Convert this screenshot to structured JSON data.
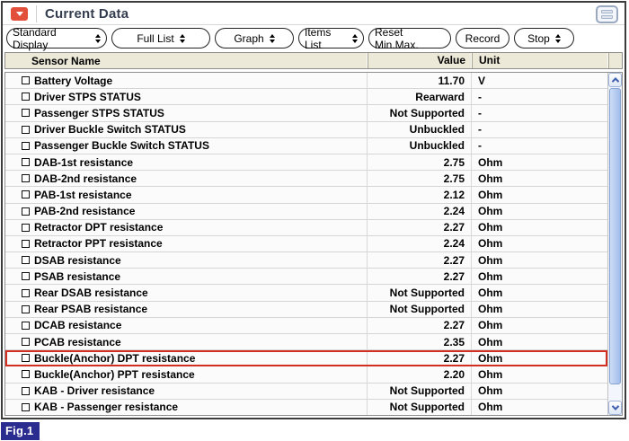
{
  "window": {
    "title": "Current Data",
    "titlebar_icon": "red-dropdown-caret",
    "corner_icon": "window-stack"
  },
  "toolbar": {
    "buttons": [
      {
        "label": "Standard Display",
        "dropdown": true
      },
      {
        "label": "Full List",
        "dropdown": true
      },
      {
        "label": "Graph",
        "dropdown": true
      },
      {
        "label": "Items List",
        "dropdown": true
      },
      {
        "label": "Reset Min.Max.",
        "dropdown": false
      },
      {
        "label": "Record",
        "dropdown": false
      },
      {
        "label": "Stop",
        "dropdown": true
      }
    ]
  },
  "table": {
    "columns": {
      "name": "Sensor Name",
      "value": "Value",
      "unit": "Unit"
    },
    "rows": [
      {
        "name": "Battery Voltage",
        "value": "11.70",
        "unit": "V",
        "checked": false,
        "highlighted": false
      },
      {
        "name": "Driver STPS STATUS",
        "value": "Rearward",
        "unit": "-",
        "checked": false,
        "highlighted": false
      },
      {
        "name": "Passenger STPS STATUS",
        "value": "Not Supported",
        "unit": "-",
        "checked": false,
        "highlighted": false
      },
      {
        "name": "Driver Buckle Switch STATUS",
        "value": "Unbuckled",
        "unit": "-",
        "checked": false,
        "highlighted": false
      },
      {
        "name": "Passenger Buckle Switch STATUS",
        "value": "Unbuckled",
        "unit": "-",
        "checked": false,
        "highlighted": false
      },
      {
        "name": "DAB-1st resistance",
        "value": "2.75",
        "unit": "Ohm",
        "checked": false,
        "highlighted": false
      },
      {
        "name": "DAB-2nd resistance",
        "value": "2.75",
        "unit": "Ohm",
        "checked": false,
        "highlighted": false
      },
      {
        "name": "PAB-1st resistance",
        "value": "2.12",
        "unit": "Ohm",
        "checked": false,
        "highlighted": false
      },
      {
        "name": "PAB-2nd resistance",
        "value": "2.24",
        "unit": "Ohm",
        "checked": false,
        "highlighted": false
      },
      {
        "name": "Retractor DPT resistance",
        "value": "2.27",
        "unit": "Ohm",
        "checked": false,
        "highlighted": false
      },
      {
        "name": "Retractor PPT resistance",
        "value": "2.24",
        "unit": "Ohm",
        "checked": false,
        "highlighted": false
      },
      {
        "name": "DSAB resistance",
        "value": "2.27",
        "unit": "Ohm",
        "checked": false,
        "highlighted": false
      },
      {
        "name": "PSAB resistance",
        "value": "2.27",
        "unit": "Ohm",
        "checked": false,
        "highlighted": false
      },
      {
        "name": "Rear DSAB resistance",
        "value": "Not Supported",
        "unit": "Ohm",
        "checked": false,
        "highlighted": false
      },
      {
        "name": "Rear PSAB resistance",
        "value": "Not Supported",
        "unit": "Ohm",
        "checked": false,
        "highlighted": false
      },
      {
        "name": "DCAB resistance",
        "value": "2.27",
        "unit": "Ohm",
        "checked": false,
        "highlighted": false
      },
      {
        "name": "PCAB resistance",
        "value": "2.35",
        "unit": "Ohm",
        "checked": false,
        "highlighted": false
      },
      {
        "name": "Buckle(Anchor) DPT resistance",
        "value": "2.27",
        "unit": "Ohm",
        "checked": false,
        "highlighted": true
      },
      {
        "name": "Buckle(Anchor) PPT resistance",
        "value": "2.20",
        "unit": "Ohm",
        "checked": false,
        "highlighted": false
      },
      {
        "name": "KAB - Driver resistance",
        "value": "Not Supported",
        "unit": "Ohm",
        "checked": false,
        "highlighted": false
      },
      {
        "name": "KAB - Passenger resistance",
        "value": "Not Supported",
        "unit": "Ohm",
        "checked": false,
        "highlighted": false
      }
    ]
  },
  "figure_label": "Fig.1",
  "colors": {
    "highlight_border": "#d22f23",
    "titlebar_icon_red": "#e2503c",
    "header_background": "#ece9d8",
    "figure_label_background": "#2b2c90",
    "scrollbar_thumb": "#a2bdea",
    "scrollbar_arrow": "#3f5fae",
    "window_border": "#3d3d3d"
  }
}
